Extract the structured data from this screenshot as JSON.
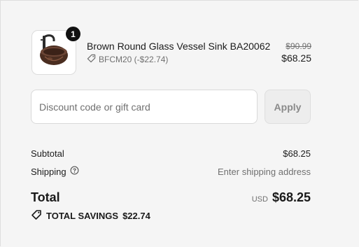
{
  "product": {
    "title": "Brown Round Glass Vessel Sink BA20062",
    "quantity": "1",
    "discount_code": "BFCM20 (-$22.74)",
    "original_price": "$90.99",
    "price": "$68.25"
  },
  "discount": {
    "placeholder": "Discount code or gift card",
    "value": "",
    "apply_label": "Apply"
  },
  "summary": {
    "subtotal_label": "Subtotal",
    "subtotal_value": "$68.25",
    "shipping_label": "Shipping",
    "shipping_value": "Enter shipping address",
    "total_label": "Total",
    "currency": "USD",
    "total_value": "$68.25",
    "savings_label": "TOTAL SAVINGS",
    "savings_value": "$22.74"
  },
  "icons": {
    "product_thumbnail": "vessel-sink-image",
    "discount_tag": "tag-icon",
    "shipping_help": "question-circle-icon",
    "savings_tag": "tag-icon"
  }
}
